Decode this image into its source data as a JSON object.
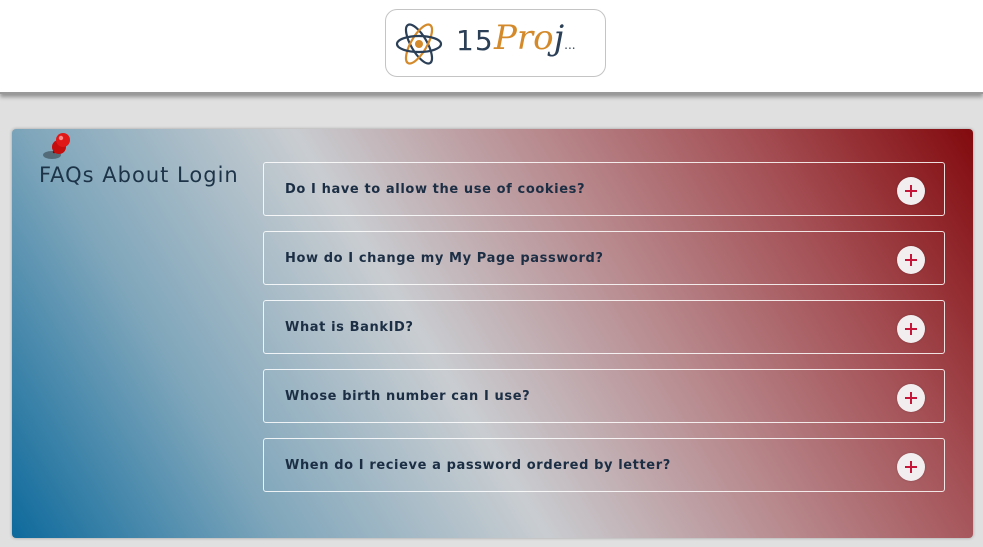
{
  "brand": {
    "number": "15",
    "word_part1": "Pro",
    "word_part2": "j",
    "suffix": "..."
  },
  "faq_section": {
    "title": "FAQs About Login",
    "items": [
      {
        "question": "Do I have to allow the use of cookies?"
      },
      {
        "question": "How do I change my My Page password?"
      },
      {
        "question": "What is BankID?"
      },
      {
        "question": "Whose birth number can I use?"
      },
      {
        "question": "When do I recieve a password ordered by letter?"
      }
    ]
  },
  "colors": {
    "accent_plus": "#c7153a",
    "gradient_start": "#0d6a9c",
    "gradient_end": "#820a0e",
    "logo_orange": "#d48a2a",
    "logo_navy": "#2b3f57"
  },
  "icons": {
    "logo": "atom-icon",
    "pin": "pushpin-icon",
    "expand": "plus-icon"
  }
}
